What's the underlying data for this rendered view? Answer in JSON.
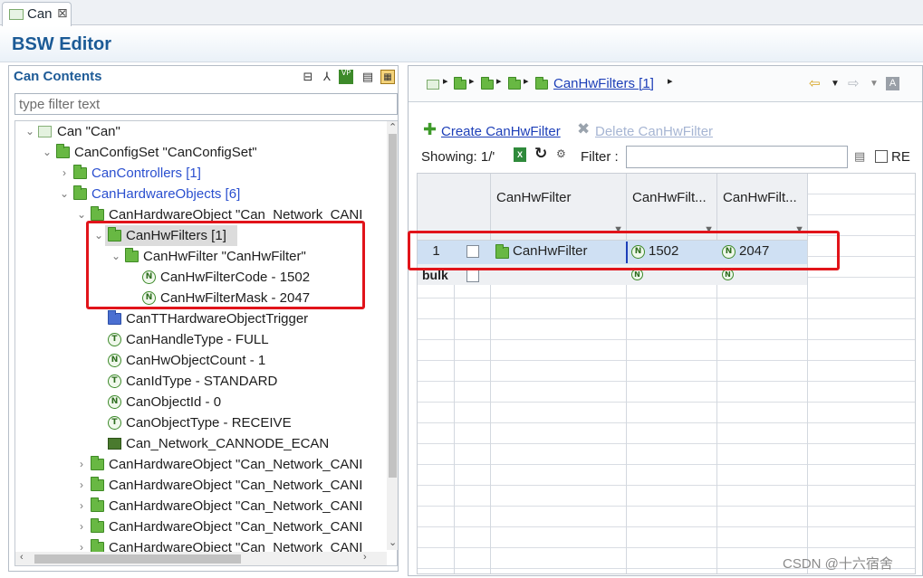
{
  "tab": {
    "title": "Can",
    "close": "⊠"
  },
  "editor": {
    "title": "BSW Editor"
  },
  "left": {
    "header": "Can Contents",
    "filter_placeholder": "type filter text",
    "tree": [
      {
        "label": "Can \"Can\""
      },
      {
        "label": "CanConfigSet \"CanConfigSet\""
      },
      {
        "label": "CanControllers [1]"
      },
      {
        "label": "CanHardwareObjects [6]"
      },
      {
        "label": "CanHardwareObject \"Can_Network_CANI"
      },
      {
        "label": "CanHwFilters [1]"
      },
      {
        "label": "CanHwFilter \"CanHwFilter\""
      },
      {
        "label": "CanHwFilterCode - 1502"
      },
      {
        "label": "CanHwFilterMask - 2047"
      },
      {
        "label": "CanTTHardwareObjectTrigger"
      },
      {
        "label": "CanHandleType - FULL"
      },
      {
        "label": "CanHwObjectCount - 1"
      },
      {
        "label": "CanIdType - STANDARD"
      },
      {
        "label": "CanObjectId - 0"
      },
      {
        "label": "CanObjectType - RECEIVE"
      },
      {
        "label": "Can_Network_CANNODE_ECAN"
      },
      {
        "label": "CanHardwareObject \"Can_Network_CANI"
      },
      {
        "label": "CanHardwareObject \"Can_Network_CANI"
      },
      {
        "label": "CanHardwareObject \"Can_Network_CANI"
      },
      {
        "label": "CanHardwareObject \"Can_Network_CANI"
      },
      {
        "label": "CanHardwareObject \"Can_Network_CANI"
      }
    ]
  },
  "right": {
    "breadcrumb": "CanHwFilters [1]",
    "create_label": "Create CanHwFilter",
    "delete_label": "Delete CanHwFilter",
    "showing_label": "Showing: 1/'",
    "filter_label": "Filter :",
    "re_label": "RE",
    "table": {
      "columns": [
        "CanHwFilter",
        "CanHwFilt...",
        "CanHwFilt..."
      ],
      "rows": [
        {
          "num": "1",
          "name": "CanHwFilter",
          "code": "1502",
          "mask": "2047"
        }
      ],
      "bulk_label": "bulk"
    }
  },
  "watermark": "CSDN @十六宿舍",
  "colors": {
    "title_blue": "#1b5a96",
    "folder_green": "#68b843",
    "highlight_red": "#e1141a",
    "link_blue": "#1d3fb8"
  }
}
